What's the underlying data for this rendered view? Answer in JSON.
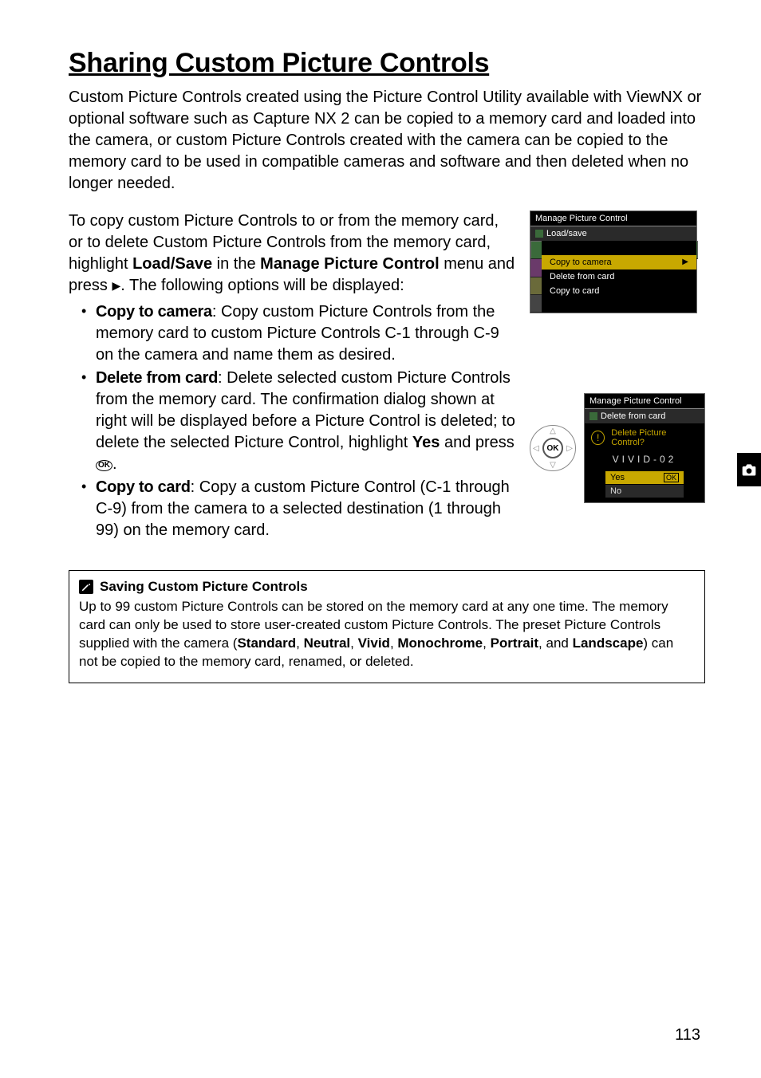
{
  "title": "Sharing Custom Picture Controls",
  "intro": "Custom Picture Controls created using the Picture Control Utility available with ViewNX or optional software such as Capture NX 2 can be copied to a memory card and loaded into the camera, or custom Picture Controls created with the camera can be copied to the memory card to be used in compatible cameras and software and then deleted when no longer needed.",
  "para_lead": "To copy custom Picture Controls to or from the memory card, or to delete Custom Picture Controls from the memory card, highlight ",
  "para_bold1": "Load/Save",
  "para_mid": " in the ",
  "para_bold2": "Manage Picture Control",
  "para_after": " menu and press ",
  "para_tail": ".  The following options will be displayed:",
  "opts": {
    "a_label": "Copy to camera",
    "a_text": ": Copy custom Picture Controls from the memory card to custom Picture Controls C-1 through C-9 on the camera and name them as desired.",
    "b_label": "Delete from card",
    "b_text_1": ": Delete selected custom Picture Controls from the memory card.  The confirmation dialog shown at right will be displayed before a Picture Control is deleted; to delete the selected Picture Control, highlight ",
    "b_yes": "Yes",
    "b_text_2": " and press ",
    "b_text_3": ".",
    "c_label": "Copy to card",
    "c_text": ": Copy a custom Picture Control (C-1 through C-9) from the camera to a selected destination (1 through 99) on the memory card."
  },
  "cam1": {
    "title": "Manage Picture Control",
    "sub": "Load/save",
    "items": [
      "Copy to camera",
      "Delete from card",
      "Copy to card"
    ]
  },
  "cam2": {
    "title": "Manage Picture Control",
    "sub": "Delete from card",
    "question": "Delete Picture Control?",
    "name": "VIVID-02",
    "yes": "Yes",
    "no": "No",
    "ok": "OK"
  },
  "okpad": "OK",
  "note": {
    "title": "Saving Custom Picture Controls",
    "body_1": "Up to 99 custom Picture Controls can be stored on the memory card at any one time.  The memory card can only be used to store user-created custom Picture Controls.  The preset Picture Controls supplied with the camera (",
    "b1": "Standard",
    "c1": ", ",
    "b2": "Neutral",
    "c2": ", ",
    "b3": "Vivid",
    "c3": ", ",
    "b4": "Monochrome",
    "c4": ", ",
    "b5": "Portrait",
    "c5": ", and ",
    "b6": "Landscape",
    "body_2": ") can not be copied to the memory card, renamed, or deleted."
  },
  "pagenum": "113"
}
